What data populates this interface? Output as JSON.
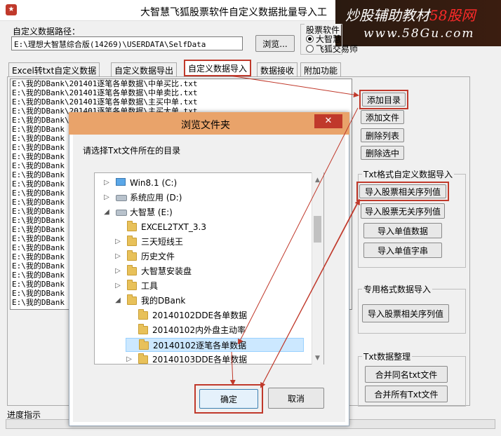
{
  "window": {
    "title": "大智慧飞狐股票软件自定义数据批量导入工",
    "watermark_title_a": "炒股辅助教材",
    "watermark_title_b": "58股网",
    "watermark_url": "www.58Gu.com"
  },
  "path": {
    "label": "自定义数据路径：",
    "value": "E:\\理想大智慧综合版(14269)\\USERDATA\\SelfData",
    "browse_label": "浏览..."
  },
  "stock_software": {
    "label": "股票软件",
    "options": [
      "大智慧",
      "飞狐交易师"
    ],
    "selected": 0
  },
  "tabs": [
    {
      "label": "Excel转txt自定义数据"
    },
    {
      "label": "自定义数据导出"
    },
    {
      "label": "自定义数据导入"
    },
    {
      "label": "数据接收"
    },
    {
      "label": "附加功能"
    }
  ],
  "file_list": [
    "E:\\我的DBank\\201401逐笔各单数据\\中单买比.txt",
    "E:\\我的DBank\\201401逐笔各单数据\\中单卖比.txt",
    "E:\\我的DBank\\201401逐笔各单数据\\主买中单.txt",
    "E:\\我的DBank\\201401逐笔各单数据\\主买大单.txt",
    "E:\\我的DBank\\201401逐笔各单数据\\主买小单.txt",
    "E:\\我的DBank",
    "E:\\我的DBank",
    "E:\\我的DBank",
    "E:\\我的DBank",
    "E:\\我的DBank",
    "E:\\我的DBank",
    "E:\\我的DBank",
    "E:\\我的DBank",
    "E:\\我的DBank",
    "E:\\我的DBank",
    "E:\\我的DBank",
    "E:\\我的DBank",
    "E:\\我的DBank",
    "E:\\我的DBank",
    "E:\\我的DBank",
    "E:\\我的DBank",
    "E:\\我的DBank",
    "E:\\我的DBank",
    "E:\\我的DBank",
    "E:\\我的DBank"
  ],
  "side": {
    "add_dir": "添加目录",
    "add_file": "添加文件",
    "del_list": "删除列表",
    "del_selected": "删除选中",
    "txt_group_label": "Txt格式自定义数据导入",
    "import_related": "导入股票相关序列值",
    "import_unrelated": "导入股票无关序列值",
    "import_single_data": "导入单值数据",
    "import_single_str": "导入单值字串",
    "special_group_label": "专用格式数据导入",
    "special_import": "导入股票相关序列值",
    "org_group_label": "Txt数据整理",
    "merge_same": "合并同名txt文件",
    "merge_all": "合并所有Txt文件"
  },
  "progress": {
    "label": "进度指示"
  },
  "dialog": {
    "title": "浏览文件夹",
    "close": "✕",
    "prompt": "请选择Txt文件所在的目录",
    "ok": "确定",
    "cancel": "取消",
    "tree": [
      {
        "label": "Win8.1 (C:)",
        "kind": "pc",
        "indent": 0,
        "chev": "▷"
      },
      {
        "label": "系统应用 (D:)",
        "kind": "drive",
        "indent": 0,
        "chev": "▷"
      },
      {
        "label": "大智慧 (E:)",
        "kind": "drive",
        "indent": 0,
        "chev": "◢"
      },
      {
        "label": "EXCEL2TXT_3.3",
        "kind": "folder",
        "indent": 1,
        "chev": ""
      },
      {
        "label": "三天短线王",
        "kind": "folder",
        "indent": 1,
        "chev": "▷"
      },
      {
        "label": "历史文件",
        "kind": "folder",
        "indent": 1,
        "chev": "▷"
      },
      {
        "label": "大智慧安装盘",
        "kind": "folder",
        "indent": 1,
        "chev": "▷"
      },
      {
        "label": "工具",
        "kind": "folder",
        "indent": 1,
        "chev": "▷"
      },
      {
        "label": "我的DBank",
        "kind": "folder",
        "indent": 1,
        "chev": "◢"
      },
      {
        "label": "20140102DDE各单数据",
        "kind": "folder",
        "indent": 2,
        "chev": ""
      },
      {
        "label": "20140102内外盘主动率",
        "kind": "folder",
        "indent": 2,
        "chev": ""
      },
      {
        "label": "20140102逐笔各单数据",
        "kind": "folder",
        "indent": 2,
        "chev": "",
        "selected": true
      },
      {
        "label": "20140103DDE各单数据",
        "kind": "folder",
        "indent": 2,
        "chev": "▷"
      }
    ]
  },
  "colors": {
    "highlight": "#c0392b",
    "dialog_titlebar": "#e9a36a",
    "selection": "#cce8ff"
  }
}
